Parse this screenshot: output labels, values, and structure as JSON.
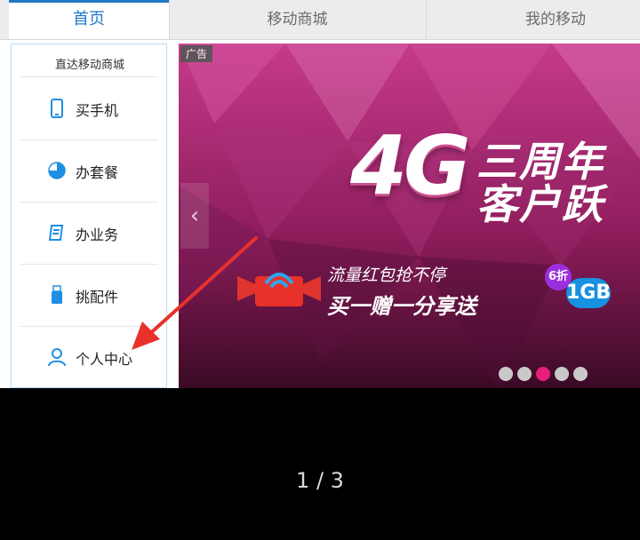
{
  "top_nav": {
    "tabs": [
      {
        "label": "首页"
      },
      {
        "label": "移动商城"
      },
      {
        "label": "我的移动"
      }
    ]
  },
  "sidebar": {
    "title": "直达移动商城",
    "items": [
      {
        "label": "买手机",
        "icon": "phone-icon"
      },
      {
        "label": "办套餐",
        "icon": "package-icon"
      },
      {
        "label": "办业务",
        "icon": "service-icon"
      },
      {
        "label": "挑配件",
        "icon": "usb-icon"
      },
      {
        "label": "个人中心",
        "icon": "user-icon"
      }
    ]
  },
  "banner": {
    "ad_tag": "广告",
    "headline_4g": "4G",
    "headline_line1": "三周年",
    "headline_line2": "客户跃",
    "promo_line1": "流量红包抢不停",
    "promo_line2": "买一赠一分享送",
    "badge_discount": "6折",
    "badge_data": "1GB",
    "slides_total": 5,
    "active_slide_index": 2
  },
  "viewer": {
    "counter": "1 / 3"
  },
  "colors": {
    "accent": "#1f78c8",
    "banner_pink": "#e61f7a",
    "arrow_red": "#e8312b"
  }
}
